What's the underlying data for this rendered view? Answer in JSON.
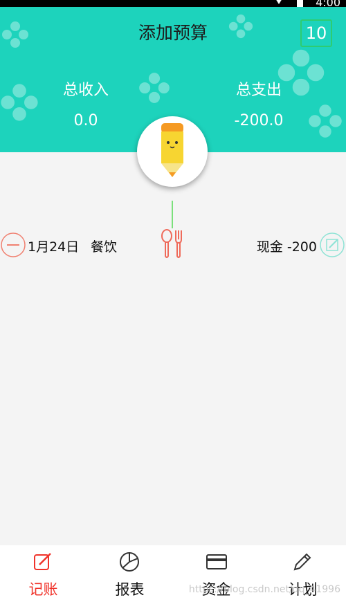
{
  "status_bar": {
    "time": "4:00"
  },
  "header": {
    "title": "添加预算",
    "calendar_day": "10",
    "total_income_label": "总收入",
    "total_income_value": "0.0",
    "total_expense_label": "总支出",
    "total_expense_value": "-200.0",
    "background_color": "#1dd3bc"
  },
  "records": [
    {
      "date": "1月24日",
      "category": "餐饮",
      "category_icon": "fork-spoon-icon",
      "account_amount": "现金 -200"
    }
  ],
  "bottom_nav": {
    "items": [
      {
        "label": "记账",
        "icon": "edit-icon",
        "active": true
      },
      {
        "label": "报表",
        "icon": "pie-chart-icon",
        "active": false
      },
      {
        "label": "资金",
        "icon": "card-icon",
        "active": false
      },
      {
        "label": "计划",
        "icon": "pencil-icon",
        "active": false
      }
    ],
    "watermark": "https://blog.csdn.net/qq_41996"
  },
  "colors": {
    "accent": "#1dd3bc",
    "active_tab": "#f0332a",
    "timeline": "#7be07b"
  }
}
